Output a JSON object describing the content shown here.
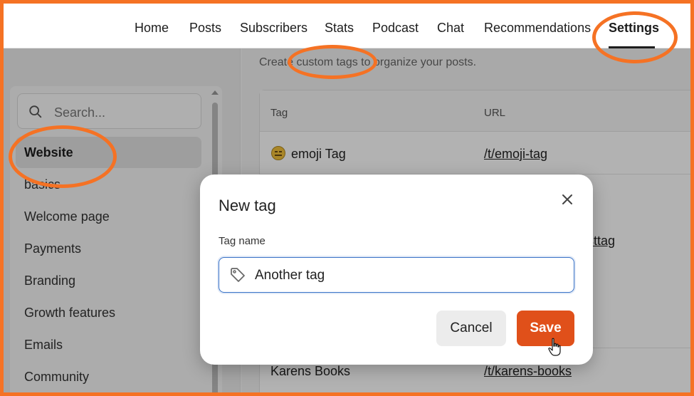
{
  "nav": {
    "items": [
      "Home",
      "Posts",
      "Subscribers",
      "Stats",
      "Podcast",
      "Chat",
      "Recommendations",
      "Settings"
    ],
    "active": "Settings"
  },
  "sidebar": {
    "search_placeholder": "Search...",
    "items": [
      "Website",
      "basics",
      "Welcome page",
      "Payments",
      "Branding",
      "Growth features",
      "Emails",
      "Community"
    ],
    "active": "Website"
  },
  "main": {
    "intro": "Create custom tags to organize your posts.",
    "table": {
      "headers": [
        "Tag",
        "URL"
      ],
      "rows": [
        {
          "tag": "emoji Tag",
          "url": "/t/emoji-tag",
          "emoji": "expressionless-face"
        },
        {
          "tag": "",
          "url": "sttag"
        },
        {
          "tag": "Karens Books",
          "url": "/t/karens-books"
        }
      ]
    }
  },
  "modal": {
    "title": "New tag",
    "field_label": "Tag name",
    "field_value": "Another tag",
    "cancel_label": "Cancel",
    "save_label": "Save"
  },
  "colors": {
    "accent": "#e0501a",
    "annotation": "#f57224",
    "focus": "#3a73c7"
  }
}
